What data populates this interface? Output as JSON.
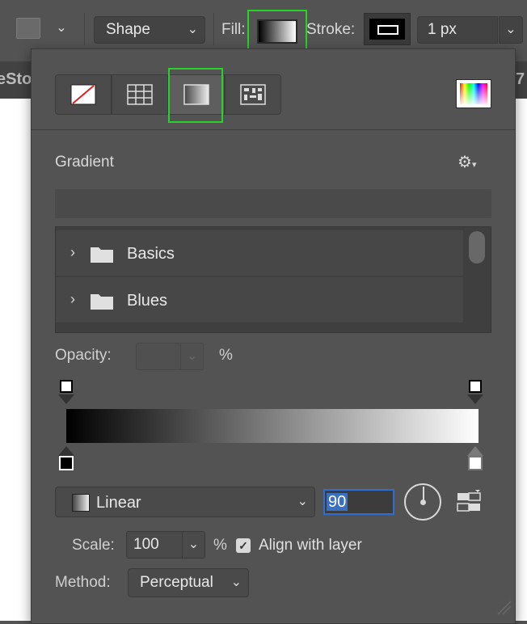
{
  "options_bar": {
    "mode_label": "Shape",
    "fill_label": "Fill:",
    "stroke_label": "Stroke:",
    "stroke_width": "1 px"
  },
  "tab_strip": {
    "left_fragment": "eSto",
    "right_fragment": "7"
  },
  "panel": {
    "fill_types": [
      {
        "name": "No Color",
        "icon": "no-color-icon"
      },
      {
        "name": "Solid Color",
        "icon": "solid-color-grid-icon"
      },
      {
        "name": "Gradient",
        "icon": "gradient-icon",
        "active": true
      },
      {
        "name": "Pattern",
        "icon": "pattern-icon"
      }
    ],
    "section_title": "Gradient",
    "gradient_groups": [
      {
        "label": "Basics"
      },
      {
        "label": "Blues"
      }
    ],
    "opacity_label": "Opacity:",
    "opacity_value": "",
    "opacity_unit": "%",
    "gradient_colors": {
      "start": "#000000",
      "end": "#ffffff"
    },
    "gradient_type": "Linear",
    "angle": "90",
    "scale_label": "Scale:",
    "scale_value": "100",
    "scale_unit": "%",
    "align_with_layer": {
      "label": "Align with layer",
      "checked": true
    },
    "method_label": "Method:",
    "method_value": "Perceptual"
  },
  "colors": {
    "highlight": "#28d228",
    "panel_bg": "#535353",
    "focus_blue": "#2f6fd1"
  }
}
